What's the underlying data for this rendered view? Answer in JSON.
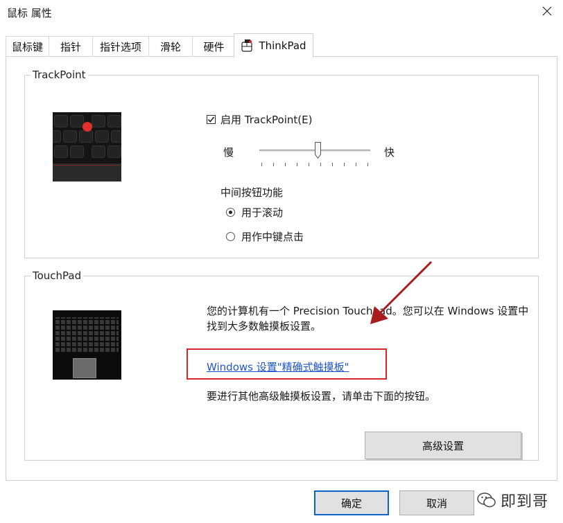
{
  "window": {
    "title": "鼠标 属性"
  },
  "tabs": [
    {
      "label": "鼠标键"
    },
    {
      "label": "指针"
    },
    {
      "label": "指针选项"
    },
    {
      "label": "滑轮"
    },
    {
      "label": "硬件"
    },
    {
      "label": "ThinkPad",
      "active": true
    }
  ],
  "trackpoint": {
    "group_label": "TrackPoint",
    "enable_label": "启用 TrackPoint(E)",
    "enabled": true,
    "speed_slow_label": "慢",
    "speed_fast_label": "快",
    "speed_ticks": 10,
    "speed_level": 0.53,
    "middle_button_title": "中间按钮功能",
    "middle_options": [
      {
        "label": "用于滚动",
        "selected": true
      },
      {
        "label": "用作中键点击",
        "selected": false
      }
    ]
  },
  "touchpad": {
    "group_label": "TouchPad",
    "description": "您的计算机有一个 Precision Touchpad。您可以在 Windows 设置中找到大多数触摸板设置。",
    "link_label": "Windows 设置\"精确式触摸板\"",
    "advanced_hint": "要进行其他高级触摸板设置，请单击下面的按钮。",
    "advanced_button": "高级设置"
  },
  "footer": {
    "ok_label": "确定",
    "cancel_label": "取消"
  },
  "watermark": {
    "text": "即到哥"
  },
  "colors": {
    "annotation_red": "#d9262b",
    "link_blue": "#1e56c8",
    "arrow_red": "#a81d1d",
    "default_button_border": "#0a64c8"
  }
}
